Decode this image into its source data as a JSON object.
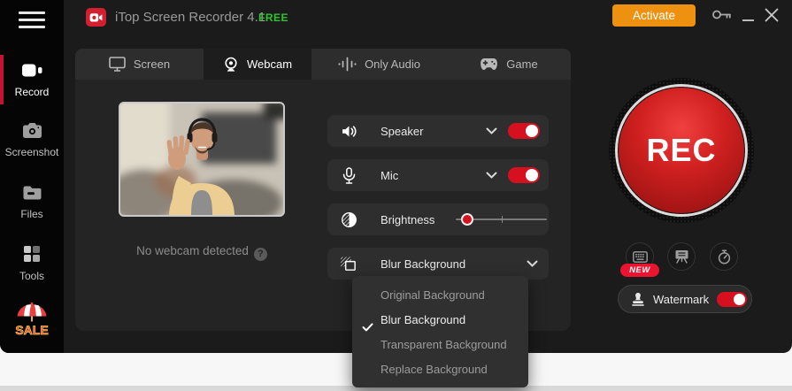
{
  "window": {
    "title": "iTop Screen Recorder 4.1",
    "license_badge": "FREE",
    "activate_label": "Activate"
  },
  "sidebar": {
    "items": [
      {
        "label": "Record",
        "icon": "video-camera",
        "active": true
      },
      {
        "label": "Screenshot",
        "icon": "photo-camera",
        "active": false
      },
      {
        "label": "Files",
        "icon": "folder",
        "active": false
      },
      {
        "label": "Tools",
        "icon": "grid",
        "active": false
      }
    ],
    "sale_text": "SALE"
  },
  "tabs": [
    {
      "label": "Screen",
      "icon": "monitor",
      "active": false
    },
    {
      "label": "Webcam",
      "icon": "webcam",
      "active": true
    },
    {
      "label": "Only Audio",
      "icon": "waveform",
      "active": false
    },
    {
      "label": "Game",
      "icon": "gamepad",
      "active": false
    }
  ],
  "webcam": {
    "status_text": "No webcam detected",
    "help_glyph": "?"
  },
  "controls": {
    "speaker": {
      "label": "Speaker",
      "enabled": true
    },
    "mic": {
      "label": "Mic",
      "enabled": true
    },
    "brightness": {
      "label": "Brightness",
      "value_percent": 12
    },
    "background": {
      "value": "Blur Background"
    }
  },
  "background_menu": {
    "items": [
      {
        "label": "Original Background",
        "selected": false
      },
      {
        "label": "Blur Background",
        "selected": true
      },
      {
        "label": "Transparent Background",
        "selected": false
      },
      {
        "label": "Replace Background",
        "selected": false
      }
    ]
  },
  "record": {
    "rec_label": "REC",
    "new_badge": "NEW",
    "watermark": {
      "label": "Watermark",
      "enabled": true
    }
  },
  "colors": {
    "accent_red": "#d6101f",
    "activate_orange": "#ee9110",
    "free_green": "#2dc52d",
    "rec_red": "#c01616",
    "new_badge_red": "#ea1430",
    "logo_red": "#d41f30"
  }
}
